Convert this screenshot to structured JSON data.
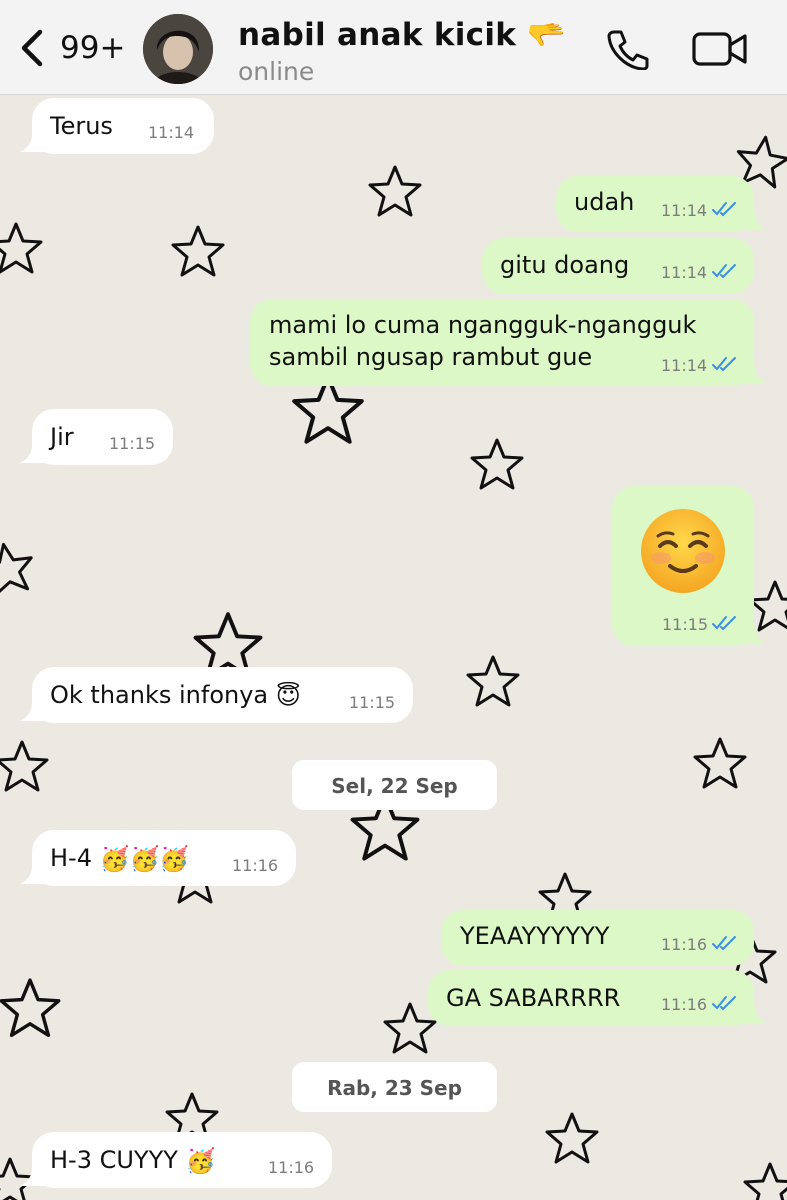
{
  "header": {
    "back_count": "99+",
    "contact_name": "nabil anak kicik",
    "contact_emoji": "🫳",
    "status": "online"
  },
  "messages": [
    {
      "side": "in",
      "text": "Terus",
      "time": "11:14"
    },
    {
      "side": "out",
      "text": "udah",
      "time": "11:14"
    },
    {
      "side": "out",
      "text": "gitu doang",
      "time": "11:14"
    },
    {
      "side": "out",
      "text_line1": "mami lo cuma ngangguk-ngangguk",
      "text_line2": "sambil ngusap rambut gue",
      "time": "11:14"
    },
    {
      "side": "in",
      "text": "Jir",
      "time": "11:15"
    },
    {
      "side": "out",
      "emoji": "☺️",
      "time": "11:15"
    },
    {
      "side": "in",
      "text": "Ok thanks infonya",
      "emoji": "😇",
      "time": "11:15"
    },
    {
      "side": "in",
      "text": "H-4",
      "emoji": "🥳🥳🥳",
      "time": "11:16"
    },
    {
      "side": "out",
      "text": "YEAAYYYYYY",
      "time": "11:16"
    },
    {
      "side": "out",
      "text": "GA SABARRRR",
      "time": "11:16"
    },
    {
      "side": "in",
      "text": "H-3 CUYYY",
      "emoji": "🥳",
      "time": "11:16"
    }
  ],
  "dates": [
    "Sel, 22 Sep",
    "Rab, 23 Sep"
  ],
  "colors": {
    "incoming": "#ffffff",
    "outgoing": "#dcf8c6",
    "read_ticks": "#3a8ee6",
    "background": "#ece9e3"
  },
  "icons": [
    "back-chevron-icon",
    "phone-icon",
    "video-call-icon",
    "read-ticks-icon",
    "star-pattern"
  ]
}
